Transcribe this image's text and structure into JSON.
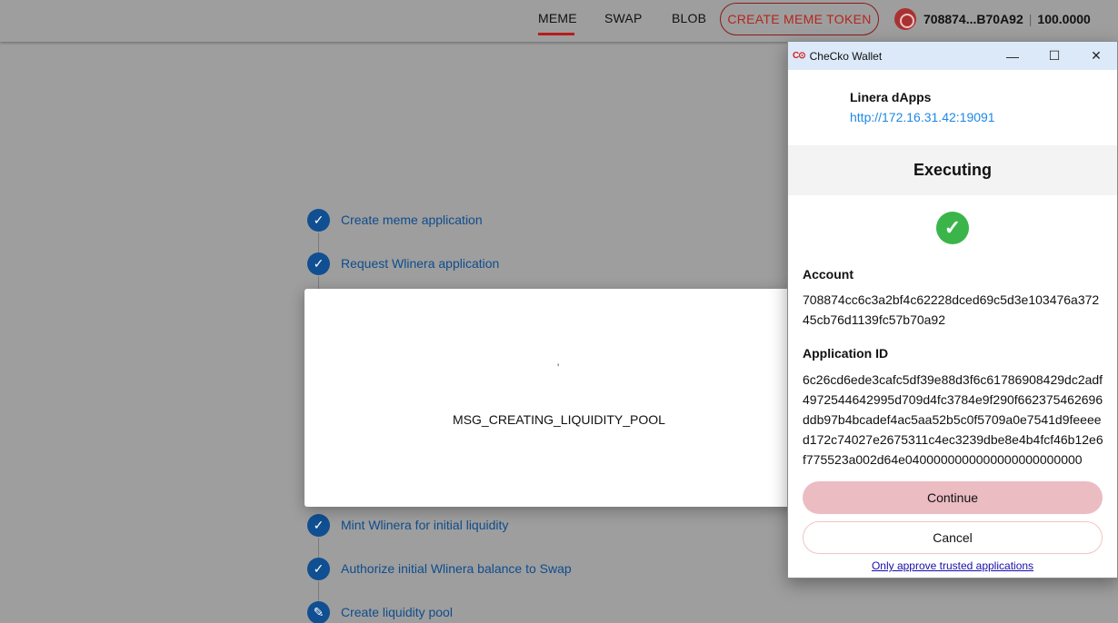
{
  "nav": {
    "items": [
      "MEME",
      "SWAP",
      "BLOB"
    ],
    "create_label": "CREATE MEME TOKEN",
    "account_address": "708874...B70A92",
    "account_balance": "100.0000"
  },
  "steps": [
    {
      "label": "Create meme application",
      "state": "done"
    },
    {
      "label": "Request Wlinera application",
      "state": "done"
    },
    {
      "label": "Mint Wlinera for initial liquidity",
      "state": "done"
    },
    {
      "label": "Authorize initial Wlinera balance to Swap",
      "state": "done"
    },
    {
      "label": "Create liquidity pool",
      "state": "editing"
    }
  ],
  "dialog": {
    "spinner_text": "'",
    "message": "MSG_CREATING_LIQUIDITY_POOL"
  },
  "wallet": {
    "logo": "C⊙",
    "title": "CheCko Wallet",
    "dapp_name": "Linera dApps",
    "dapp_url": "http://172.16.31.42:19091",
    "status": "Executing",
    "account_label": "Account",
    "account_value": "708874cc6c3a2bf4c62228dced69c5d3e103476a37245cb76d1139fc57b70a92",
    "app_id_label": "Application ID",
    "app_id_value": "6c26cd6ede3cafc5df39e88d3f6c61786908429dc2adf4972544642995d709d4fc3784e9f290f662375462696ddb97b4bcadef4ac5aa52b5c0f5709a0e7541d9feeeed172c74027e2675311c4ec3239dbe8e4b4fcf46b12e6f775523a002d64e0400000000000000000000000",
    "continue_label": "Continue",
    "cancel_label": "Cancel",
    "trusted_text": "Only approve trusted applications"
  },
  "colors": {
    "accent": "#b71c1c",
    "step": "#104f91",
    "success": "#3bb54a",
    "continue": "#ebbcc2"
  }
}
